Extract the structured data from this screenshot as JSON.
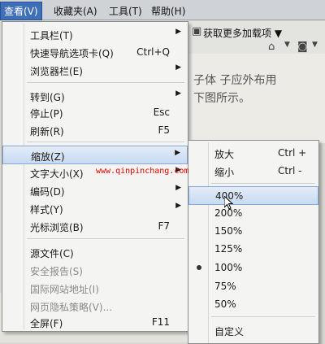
{
  "menubar": {
    "items": [
      {
        "label": "查看(V)"
      },
      {
        "label": "收藏夹(A)"
      },
      {
        "label": "工具(T)"
      },
      {
        "label": "帮助(H)"
      }
    ]
  },
  "toolbar": {
    "more_addons": "获取更多加载项 ▼",
    "home_icon": "home-icon",
    "rss_icon": "rss-icon"
  },
  "background_text": {
    "line1": "子体  子应外布用",
    "line2": "下图所示。"
  },
  "watermark": "www.qinpinchang.com",
  "view_menu": {
    "items": [
      {
        "label": "工具栏(T)",
        "shortcut": "",
        "submenu": true,
        "disabled": false
      },
      {
        "label": "快速导航选项卡(Q)",
        "shortcut": "Ctrl+Q",
        "submenu": false,
        "disabled": false
      },
      {
        "label": "浏览器栏(E)",
        "shortcut": "",
        "submenu": true,
        "disabled": false
      },
      {
        "label": "转到(G)",
        "shortcut": "",
        "submenu": true,
        "disabled": false
      },
      {
        "label": "停止(P)",
        "shortcut": "Esc",
        "submenu": false,
        "disabled": false
      },
      {
        "label": "刷新(R)",
        "shortcut": "F5",
        "submenu": false,
        "disabled": false
      },
      {
        "label": "缩放(Z)",
        "shortcut": "",
        "submenu": true,
        "disabled": false,
        "highlight": true
      },
      {
        "label": "文字大小(X)",
        "shortcut": "",
        "submenu": true,
        "disabled": false
      },
      {
        "label": "编码(D)",
        "shortcut": "",
        "submenu": true,
        "disabled": false
      },
      {
        "label": "样式(Y)",
        "shortcut": "",
        "submenu": true,
        "disabled": false
      },
      {
        "label": "光标浏览(B)",
        "shortcut": "F7",
        "submenu": false,
        "disabled": false
      },
      {
        "label": "源文件(C)",
        "shortcut": "",
        "submenu": false,
        "disabled": false
      },
      {
        "label": "安全报告(S)",
        "shortcut": "",
        "submenu": false,
        "disabled": true
      },
      {
        "label": "国际网站地址(I)",
        "shortcut": "",
        "submenu": false,
        "disabled": true
      },
      {
        "label": "网页隐私策略(V)...",
        "shortcut": "",
        "submenu": false,
        "disabled": true
      },
      {
        "label": "全屏(F)",
        "shortcut": "F11",
        "submenu": false,
        "disabled": false
      }
    ]
  },
  "zoom_menu": {
    "items": [
      {
        "label": "放大",
        "shortcut": "Ctrl +"
      },
      {
        "label": "缩小",
        "shortcut": "Ctrl -"
      },
      {
        "label": "400%",
        "shortcut": "",
        "highlight": true
      },
      {
        "label": "200%",
        "shortcut": ""
      },
      {
        "label": "150%",
        "shortcut": ""
      },
      {
        "label": "125%",
        "shortcut": ""
      },
      {
        "label": "100%",
        "shortcut": "",
        "checked": true
      },
      {
        "label": "75%",
        "shortcut": ""
      },
      {
        "label": "50%",
        "shortcut": ""
      },
      {
        "label": "自定义",
        "shortcut": ""
      }
    ]
  }
}
